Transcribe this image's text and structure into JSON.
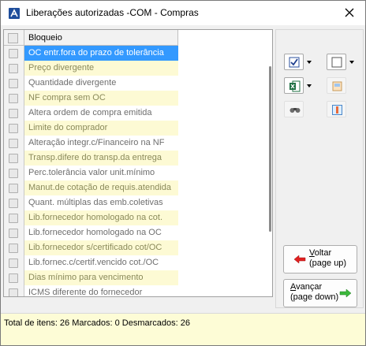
{
  "window": {
    "title": "Liberações autorizadas -COM - Compras"
  },
  "grid": {
    "column_header": "Bloqueio",
    "rows": [
      {
        "label": "OC entr.fora do prazo de tolerância",
        "checked": false,
        "selected": true
      },
      {
        "label": "Preço divergente",
        "checked": false,
        "selected": false
      },
      {
        "label": "Quantidade divergente",
        "checked": false,
        "selected": false
      },
      {
        "label": "NF compra sem OC",
        "checked": false,
        "selected": false
      },
      {
        "label": "Altera ordem de compra emitida",
        "checked": false,
        "selected": false
      },
      {
        "label": "Limite do comprador",
        "checked": false,
        "selected": false
      },
      {
        "label": "Alteração integr.c/Financeiro na NF",
        "checked": false,
        "selected": false
      },
      {
        "label": "Transp.difere do transp.da entrega",
        "checked": false,
        "selected": false
      },
      {
        "label": "Perc.tolerância valor unit.mínimo",
        "checked": false,
        "selected": false
      },
      {
        "label": "Manut.de cotação de requis.atendida",
        "checked": false,
        "selected": false
      },
      {
        "label": "Quant. múltiplas das emb.coletivas",
        "checked": false,
        "selected": false
      },
      {
        "label": "Lib.fornecedor homologado na cot.",
        "checked": false,
        "selected": false
      },
      {
        "label": "Lib.fornecedor homologado na OC",
        "checked": false,
        "selected": false
      },
      {
        "label": "Lib.fornecedor s/certificado cot/OC",
        "checked": false,
        "selected": false
      },
      {
        "label": "Lib.fornec.c/certif.vencido cot./OC",
        "checked": false,
        "selected": false
      },
      {
        "label": "Dias mínimo para vencimento",
        "checked": false,
        "selected": false
      },
      {
        "label": "ICMS diferente do fornecedor",
        "checked": false,
        "selected": false
      }
    ]
  },
  "toolbar": {
    "check_all_icon": "checkbox-checked-icon",
    "uncheck_all_icon": "checkbox-empty-icon",
    "excel_icon": "excel-icon",
    "export_icon": "export-icon",
    "search_icon": "binoculars-icon",
    "columns_icon": "columns-icon"
  },
  "nav": {
    "back_label_underlined": "V",
    "back_label_rest": "oltar",
    "back_sub": "(page up)",
    "forward_label_underlined": "A",
    "forward_label_rest": "vançar",
    "forward_sub": "(page down)"
  },
  "status": {
    "text": "Total de itens: 26 Marcados: 0 Desmarcados: 26"
  },
  "colors": {
    "selected_row": "#3399ff",
    "even_row": "#fdfad4",
    "status_bar": "#fdfcd6",
    "back_arrow": "#e02020",
    "forward_arrow": "#3cb83c"
  }
}
